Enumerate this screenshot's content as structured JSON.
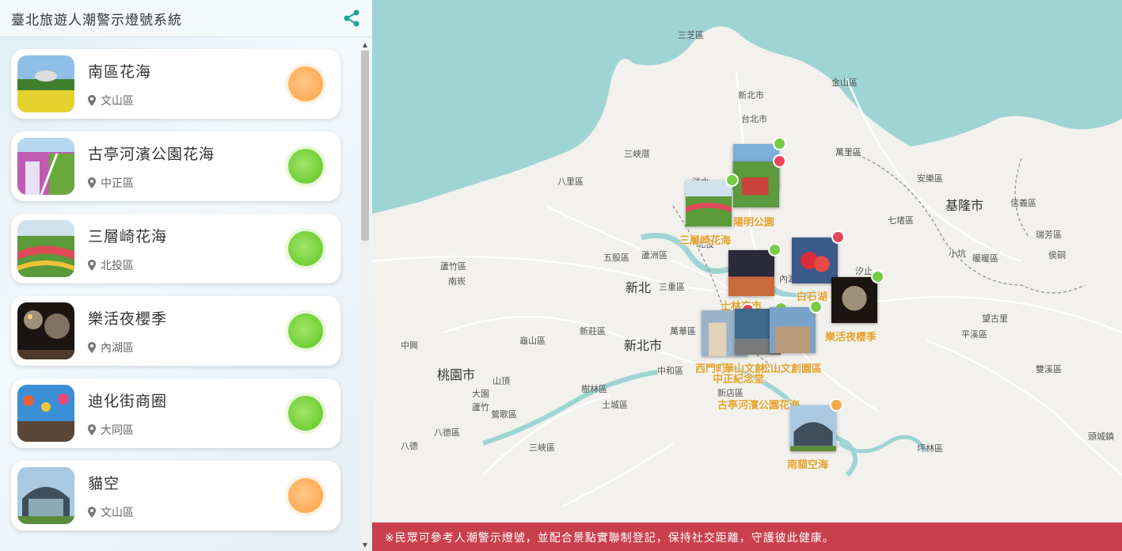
{
  "header": {
    "title": "臺北旅遊人潮警示燈號系統",
    "share_icon": "share-icon"
  },
  "colors": {
    "green": "#77cc44",
    "orange": "#ffab55",
    "red": "#e8485a",
    "notice_bg": "#c9404d",
    "water": "#9fd4d4"
  },
  "spots": [
    {
      "name": "南區花海",
      "district": "文山區",
      "light": "orange"
    },
    {
      "name": "古亭河濱公園花海",
      "district": "中正區",
      "light": "green"
    },
    {
      "name": "三層崎花海",
      "district": "北投區",
      "light": "green"
    },
    {
      "name": "樂活夜櫻季",
      "district": "內湖區",
      "light": "green"
    },
    {
      "name": "迪化街商圈",
      "district": "大同區",
      "light": "green"
    },
    {
      "name": "貓空",
      "district": "文山區",
      "light": "orange"
    }
  ],
  "map": {
    "places": [
      "三芝區",
      "金山區",
      "新北市",
      "台北市",
      "萬里區",
      "三峽厝",
      "八里區",
      "淡水",
      "安樂區",
      "基隆市",
      "信義區",
      "七堵區",
      "蘆竹區",
      "南崁",
      "五股區",
      "蘆洲區",
      "新北",
      "三重區",
      "新莊區",
      "龜山區",
      "桃園市",
      "新北市",
      "中和區",
      "萬華區",
      "樹林區",
      "土城區",
      "八德區",
      "鶯歌區",
      "三峽區",
      "坪林區",
      "雙溪區",
      "平溪區",
      "瑞芳區",
      "暖暖區",
      "望古里",
      "頭城鎮",
      "汐止",
      "小坑",
      "侯硐",
      "新店區",
      "大園",
      "山頂",
      "中興",
      "蘆竹",
      "八德",
      "內湖",
      "北投"
    ],
    "markers": [
      {
        "label": "陽明公園",
        "status": "g"
      },
      {
        "label": "陽明公園",
        "status": "r"
      },
      {
        "label": "三層崎花海",
        "status": "g"
      },
      {
        "label": "士林夜市",
        "status": "g"
      },
      {
        "label": "白石湖",
        "status": "r"
      },
      {
        "label": "樂活夜櫻季",
        "status": "g"
      },
      {
        "label": "西門町",
        "status": "r"
      },
      {
        "label": "華山文創",
        "status": "g"
      },
      {
        "label": "松山文創園區",
        "status": "g"
      },
      {
        "label": "中正紀念堂",
        "status": "g"
      },
      {
        "label": "古亭河濱公園花海",
        "status": "g"
      },
      {
        "label": "南貓空海",
        "status": "o"
      }
    ]
  },
  "notice": "※民眾可參考人潮警示燈號，並配合景點實聯制登記，保持社交距離，守護彼此健康。"
}
